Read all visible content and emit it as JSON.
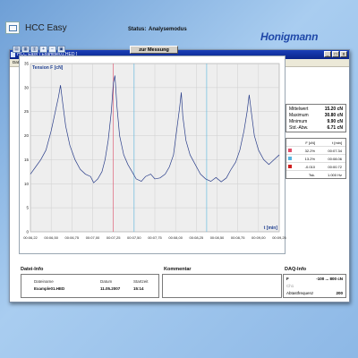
{
  "window": {
    "title": "HCC Easy [ Example01.HED ]",
    "controls": [
      "_",
      "□",
      "x"
    ]
  },
  "menu": [
    "Datei",
    "Ansicht",
    "Extras",
    "Einstellungen",
    "Hilfe"
  ],
  "header": {
    "app_title": "HCC Easy",
    "status_label": "Status:",
    "status_value": "Analysemodus",
    "brand": "Honigmann"
  },
  "toolbar": {
    "tools": [
      "open-icon",
      "save-icon",
      "print-icon",
      "zoom-in-icon",
      "zoom-out-icon",
      "measure-icon"
    ],
    "measure_button": "zur Messung"
  },
  "stats": {
    "rows": [
      {
        "label": "Mittelwert",
        "value": "15.20 cN"
      },
      {
        "label": "Maximum",
        "value": "30.80 cN"
      },
      {
        "label": "Minimum",
        "value": "9.90 cN"
      },
      {
        "label": "Std.-Abw.",
        "value": "6.71 cN"
      }
    ]
  },
  "markers": {
    "header": {
      "col1": "F [cN]",
      "col2": "t [min]"
    },
    "rows": [
      {
        "color": "#e0506a",
        "f": "32.2%",
        "t": "00:07.34"
      },
      {
        "color": "#55b5e0",
        "f": "13.2%",
        "t": "00:08.06"
      },
      {
        "color": "#d02020",
        "f": "-0.010",
        "t": "00:00.72"
      }
    ],
    "last_label": "Tsk.",
    "last_value": "1.000 Hz"
  },
  "bottom": {
    "file_section_title": "Datei-Info",
    "file_name_label": "Dateiname",
    "file_name_value": "Example01.HED",
    "date_label": "Datum",
    "date_value": "11.05.2007",
    "time_label": "Startzeit",
    "time_value": "15:14",
    "comment_title": "Kommentar",
    "daq_title": "DAQ-Info",
    "daq_rows": [
      {
        "label": "F",
        "value": "-100 ... 800 cN"
      },
      {
        "label": "Ch1",
        "value": ""
      },
      {
        "label": "Abtastfrequenz",
        "value": "200"
      }
    ]
  },
  "chart_data": {
    "type": "line",
    "title": "Tension F [cN]",
    "xlabel": "t [min]",
    "ylabel": "Tension F [cN]",
    "xlim": [
      0,
      24
    ],
    "ylim": [
      0,
      35
    ],
    "yticks": [
      0,
      5,
      10,
      15,
      20,
      25,
      30,
      35
    ],
    "xtick_labels": [
      "00:06,22",
      "00:06,50",
      "00:06,75",
      "00:07,00",
      "00:07,25",
      "00:07,50",
      "00:07,75",
      "00:08,00",
      "00:08,25",
      "00:08,50",
      "00:08,75",
      "00:09,00",
      "00:09,25"
    ],
    "grid": true,
    "markers": [
      {
        "x": 8,
        "color": "#e0506a"
      },
      {
        "x": 10,
        "color": "#55b5e0"
      },
      {
        "x": 17,
        "color": "#55b5e0"
      }
    ],
    "series": [
      {
        "color": "#2a3e8a",
        "points": [
          [
            0,
            12
          ],
          [
            0.5,
            13.5
          ],
          [
            1,
            15
          ],
          [
            1.5,
            17
          ],
          [
            2,
            21
          ],
          [
            2.4,
            25
          ],
          [
            2.7,
            28
          ],
          [
            2.9,
            30.5
          ],
          [
            3.1,
            27
          ],
          [
            3.4,
            22
          ],
          [
            3.8,
            18
          ],
          [
            4.3,
            15
          ],
          [
            4.8,
            13
          ],
          [
            5.3,
            12
          ],
          [
            5.8,
            11.5
          ],
          [
            6.1,
            10.2
          ],
          [
            6.5,
            11
          ],
          [
            6.9,
            12.5
          ],
          [
            7.2,
            15
          ],
          [
            7.5,
            19
          ],
          [
            7.8,
            25
          ],
          [
            8,
            31
          ],
          [
            8.15,
            32.5
          ],
          [
            8.35,
            26
          ],
          [
            8.6,
            20
          ],
          [
            9,
            16
          ],
          [
            9.4,
            14
          ],
          [
            9.8,
            12.5
          ],
          [
            10.2,
            11
          ],
          [
            10.7,
            10.5
          ],
          [
            11.1,
            11.5
          ],
          [
            11.6,
            12
          ],
          [
            12,
            11
          ],
          [
            12.5,
            11.2
          ],
          [
            13,
            12
          ],
          [
            13.4,
            13.5
          ],
          [
            13.8,
            16
          ],
          [
            14.1,
            21
          ],
          [
            14.4,
            26
          ],
          [
            14.55,
            29
          ],
          [
            14.7,
            24
          ],
          [
            15,
            19
          ],
          [
            15.4,
            16
          ],
          [
            15.9,
            14
          ],
          [
            16.4,
            12
          ],
          [
            16.9,
            11
          ],
          [
            17.4,
            10.5
          ],
          [
            17.9,
            11.3
          ],
          [
            18.4,
            10.4
          ],
          [
            18.9,
            11.2
          ],
          [
            19.3,
            12.8
          ],
          [
            19.8,
            14.5
          ],
          [
            20.2,
            17
          ],
          [
            20.6,
            21
          ],
          [
            20.9,
            25
          ],
          [
            21.1,
            28.5
          ],
          [
            21.3,
            25
          ],
          [
            21.6,
            20
          ],
          [
            22,
            17
          ],
          [
            22.5,
            15
          ],
          [
            23,
            14
          ],
          [
            23.5,
            15
          ],
          [
            24,
            16
          ]
        ]
      }
    ]
  }
}
